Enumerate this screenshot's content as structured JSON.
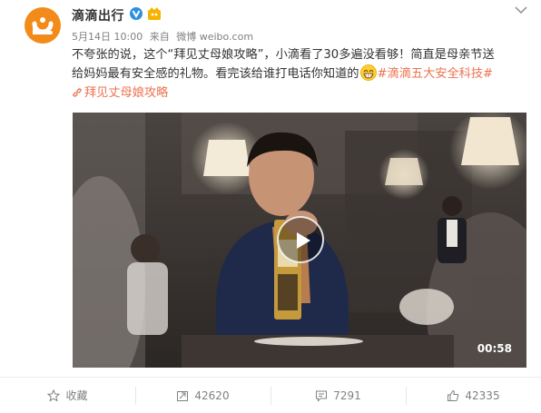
{
  "post": {
    "author": "滴滴出行",
    "date": "5月14日 10:00",
    "source_prefix": "来自",
    "source": "微博 weibo.com",
    "text_line1_a": "不夸张的说，这个“拜见丈母娘攻略”，小滴看了30多遍没看够！简直是母亲节送",
    "text_line2_a": "给妈妈最有安全感的礼物。看完该给谁打电话你知道的",
    "topic": "#滴滴五大安全科技#",
    "link_text": "拜见丈母娘攻略"
  },
  "video": {
    "duration": "00:58"
  },
  "actions": {
    "favorite_label": "收藏",
    "repost_count": "42620",
    "comment_count": "7291",
    "like_count": "42335"
  },
  "colors": {
    "brand_orange": "#f28b19",
    "topic_orange": "#eb7350",
    "verified_blue": "#2f8fdc"
  },
  "icons": [
    "didi-logo-icon",
    "verified-icon",
    "vip-badge-icon",
    "chevron-down-icon",
    "grin-emoji-icon",
    "link-icon",
    "play-icon",
    "star-icon",
    "repost-icon",
    "comment-icon",
    "like-icon"
  ]
}
